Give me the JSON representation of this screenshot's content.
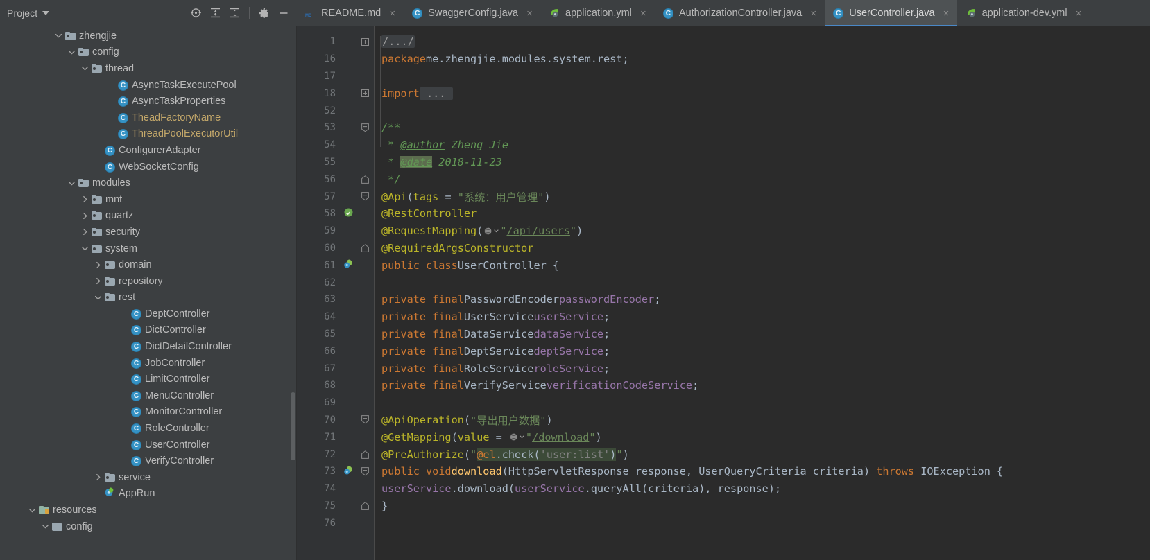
{
  "toolwindow": {
    "title": "Project",
    "caret_icon": "chevron-down-icon",
    "actions": [
      {
        "name": "locate-icon",
        "label": "Select Opened File"
      },
      {
        "name": "expand-all-icon",
        "label": "Expand All"
      },
      {
        "name": "collapse-all-icon",
        "label": "Collapse All"
      },
      {
        "name": "settings-icon",
        "label": "Settings"
      },
      {
        "name": "hide-icon",
        "label": "Hide"
      }
    ]
  },
  "tabs": [
    {
      "label": "README.md",
      "icon": "markdown-icon",
      "active": false,
      "close": "×"
    },
    {
      "label": "SwaggerConfig.java",
      "icon": "java-class-icon",
      "active": false,
      "close": "×"
    },
    {
      "label": "application.yml",
      "icon": "spring-yaml-icon",
      "active": false,
      "close": "×"
    },
    {
      "label": "AuthorizationController.java",
      "icon": "java-class-icon",
      "active": false,
      "close": "×"
    },
    {
      "label": "UserController.java",
      "icon": "java-class-icon",
      "active": true,
      "close": "×"
    },
    {
      "label": "application-dev.yml",
      "icon": "spring-yaml-icon",
      "active": false,
      "close": "×"
    }
  ],
  "tree": [
    {
      "label": "zhengjie",
      "indent": 4,
      "arrow": "down",
      "icon": "folder",
      "modified": false
    },
    {
      "label": "config",
      "indent": 5,
      "arrow": "down",
      "icon": "folder",
      "modified": false
    },
    {
      "label": "thread",
      "indent": 6,
      "arrow": "down",
      "icon": "folder",
      "modified": false
    },
    {
      "label": "AsyncTaskExecutePool",
      "indent": 8,
      "arrow": "none",
      "icon": "class",
      "modified": false
    },
    {
      "label": "AsyncTaskProperties",
      "indent": 8,
      "arrow": "none",
      "icon": "class",
      "modified": false
    },
    {
      "label": "TheadFactoryName",
      "indent": 8,
      "arrow": "none",
      "icon": "class",
      "modified": true
    },
    {
      "label": "ThreadPoolExecutorUtil",
      "indent": 8,
      "arrow": "none",
      "icon": "class",
      "modified": true
    },
    {
      "label": "ConfigurerAdapter",
      "indent": 7,
      "arrow": "none",
      "icon": "class",
      "modified": false
    },
    {
      "label": "WebSocketConfig",
      "indent": 7,
      "arrow": "none",
      "icon": "class",
      "modified": false
    },
    {
      "label": "modules",
      "indent": 5,
      "arrow": "down",
      "icon": "folder",
      "modified": false
    },
    {
      "label": "mnt",
      "indent": 6,
      "arrow": "right",
      "icon": "folder",
      "modified": false
    },
    {
      "label": "quartz",
      "indent": 6,
      "arrow": "right",
      "icon": "folder",
      "modified": false
    },
    {
      "label": "security",
      "indent": 6,
      "arrow": "right",
      "icon": "folder",
      "modified": false
    },
    {
      "label": "system",
      "indent": 6,
      "arrow": "down",
      "icon": "folder",
      "modified": false
    },
    {
      "label": "domain",
      "indent": 7,
      "arrow": "right",
      "icon": "folder",
      "modified": false
    },
    {
      "label": "repository",
      "indent": 7,
      "arrow": "right",
      "icon": "folder",
      "modified": false
    },
    {
      "label": "rest",
      "indent": 7,
      "arrow": "down",
      "icon": "folder",
      "modified": false
    },
    {
      "label": "DeptController",
      "indent": 9,
      "arrow": "none",
      "icon": "class",
      "modified": false
    },
    {
      "label": "DictController",
      "indent": 9,
      "arrow": "none",
      "icon": "class",
      "modified": false
    },
    {
      "label": "DictDetailController",
      "indent": 9,
      "arrow": "none",
      "icon": "class",
      "modified": false
    },
    {
      "label": "JobController",
      "indent": 9,
      "arrow": "none",
      "icon": "class",
      "modified": false
    },
    {
      "label": "LimitController",
      "indent": 9,
      "arrow": "none",
      "icon": "class",
      "modified": false
    },
    {
      "label": "MenuController",
      "indent": 9,
      "arrow": "none",
      "icon": "class",
      "modified": false
    },
    {
      "label": "MonitorController",
      "indent": 9,
      "arrow": "none",
      "icon": "class",
      "modified": false
    },
    {
      "label": "RoleController",
      "indent": 9,
      "arrow": "none",
      "icon": "class",
      "modified": false
    },
    {
      "label": "UserController",
      "indent": 9,
      "arrow": "none",
      "icon": "class",
      "modified": false
    },
    {
      "label": "VerifyController",
      "indent": 9,
      "arrow": "none",
      "icon": "class",
      "modified": false
    },
    {
      "label": "service",
      "indent": 7,
      "arrow": "right",
      "icon": "folder",
      "modified": false
    },
    {
      "label": "AppRun",
      "indent": 7,
      "arrow": "none",
      "icon": "spring-run",
      "modified": false
    },
    {
      "label": "resources",
      "indent": 2,
      "arrow": "down",
      "icon": "resources",
      "modified": false
    },
    {
      "label": "config",
      "indent": 3,
      "arrow": "down",
      "icon": "plainfolder",
      "modified": false
    }
  ],
  "editor": {
    "file": "UserController.java",
    "lines": [
      {
        "num": "1",
        "fold": "plus",
        "gutter": ""
      },
      {
        "num": "16",
        "fold": "",
        "gutter": ""
      },
      {
        "num": "17",
        "fold": "",
        "gutter": ""
      },
      {
        "num": "18",
        "fold": "plus",
        "gutter": ""
      },
      {
        "num": "52",
        "fold": "",
        "gutter": ""
      },
      {
        "num": "53",
        "fold": "minus",
        "gutter": ""
      },
      {
        "num": "54",
        "fold": "",
        "gutter": ""
      },
      {
        "num": "55",
        "fold": "",
        "gutter": ""
      },
      {
        "num": "56",
        "fold": "end",
        "gutter": ""
      },
      {
        "num": "57",
        "fold": "minus",
        "gutter": ""
      },
      {
        "num": "58",
        "fold": "",
        "gutter": "spring-leaf"
      },
      {
        "num": "59",
        "fold": "",
        "gutter": ""
      },
      {
        "num": "60",
        "fold": "end",
        "gutter": ""
      },
      {
        "num": "61",
        "fold": "",
        "gutter": "spring-bean"
      },
      {
        "num": "62",
        "fold": "",
        "gutter": ""
      },
      {
        "num": "63",
        "fold": "",
        "gutter": ""
      },
      {
        "num": "64",
        "fold": "",
        "gutter": ""
      },
      {
        "num": "65",
        "fold": "",
        "gutter": ""
      },
      {
        "num": "66",
        "fold": "",
        "gutter": ""
      },
      {
        "num": "67",
        "fold": "",
        "gutter": ""
      },
      {
        "num": "68",
        "fold": "",
        "gutter": ""
      },
      {
        "num": "69",
        "fold": "",
        "gutter": ""
      },
      {
        "num": "70",
        "fold": "minus",
        "gutter": ""
      },
      {
        "num": "71",
        "fold": "",
        "gutter": ""
      },
      {
        "num": "72",
        "fold": "end",
        "gutter": ""
      },
      {
        "num": "73",
        "fold": "minus",
        "gutter": "spring-bean"
      },
      {
        "num": "74",
        "fold": "",
        "gutter": ""
      },
      {
        "num": "75",
        "fold": "end",
        "gutter": ""
      },
      {
        "num": "76",
        "fold": "",
        "gutter": ""
      }
    ],
    "code": [
      "/.../",
      "package me.zhengjie.modules.system.rest;",
      "",
      "import ...",
      "",
      "/**",
      " * @author Zheng Jie",
      " * @date 2018-11-23",
      " */",
      "@Api(tags = \"系统：用户管理\")",
      "@RestController",
      "@RequestMapping(\"/api/users\")",
      "@RequiredArgsConstructor",
      "public class UserController {",
      "",
      "    private final PasswordEncoder passwordEncoder;",
      "    private final UserService userService;",
      "    private final DataService dataService;",
      "    private final DeptService deptService;",
      "    private final RoleService roleService;",
      "    private final VerifyService verificationCodeService;",
      "",
      "    @ApiOperation(\"导出用户数据\")",
      "    @GetMapping(value = \"/download\")",
      "    @PreAuthorize(\"@el.check('user:list')\")",
      "    public void download(HttpServletResponse response, UserQueryCriteria criteria) throws IOException {",
      "        userService.download(userService.queryAll(criteria), response);",
      "    }",
      ""
    ]
  },
  "colors": {
    "editor_bg": "#2b2b2b",
    "gutter_bg": "#313335",
    "panel_bg": "#3c3f41",
    "active_tab_bg": "#4e5254",
    "tab_underline": "#4a88c7",
    "keyword": "#cc7832",
    "annotation": "#bbb529",
    "string": "#6a8759",
    "comment": "#629755",
    "field": "#9876aa",
    "method": "#ffc66d",
    "text": "#a9b7c6",
    "tree_modified": "#c4a86a",
    "class_icon": "#3592c4"
  }
}
